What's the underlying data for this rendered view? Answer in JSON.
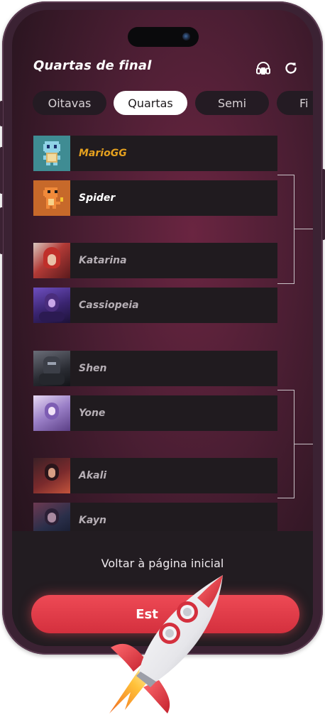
{
  "header": {
    "title": "Quartas de final",
    "icons": [
      "headset-icon",
      "refresh-icon"
    ]
  },
  "tabs": [
    {
      "label": "Oitavas",
      "active": false
    },
    {
      "label": "Quartas",
      "active": true
    },
    {
      "label": "Semi",
      "active": false
    },
    {
      "label": "Fi",
      "active": false
    }
  ],
  "bracket": {
    "players": [
      {
        "name": "MarioGG",
        "color": "#e5a11f",
        "avatar": "squirtle-avatar"
      },
      {
        "name": "Spider",
        "color": "#ffffff",
        "avatar": "charmander-avatar"
      },
      {
        "name": "Katarina",
        "color": "#b6afb5",
        "avatar": "katarina-avatar"
      },
      {
        "name": "Cassiopeia",
        "color": "#b6afb5",
        "avatar": "cassiopeia-avatar"
      },
      {
        "name": "Shen",
        "color": "#b6afb5",
        "avatar": "shen-avatar"
      },
      {
        "name": "Yone",
        "color": "#b6afb5",
        "avatar": "yone-avatar"
      },
      {
        "name": "Akali",
        "color": "#b6afb5",
        "avatar": "akali-avatar"
      },
      {
        "name": "Kayn",
        "color": "#b6afb5",
        "avatar": "kayn-avatar"
      }
    ]
  },
  "footer": {
    "back_label": "Voltar à página inicial",
    "cta_label": "Est"
  },
  "colors": {
    "accent": "#e8404c",
    "winner": "#e5a11f"
  }
}
